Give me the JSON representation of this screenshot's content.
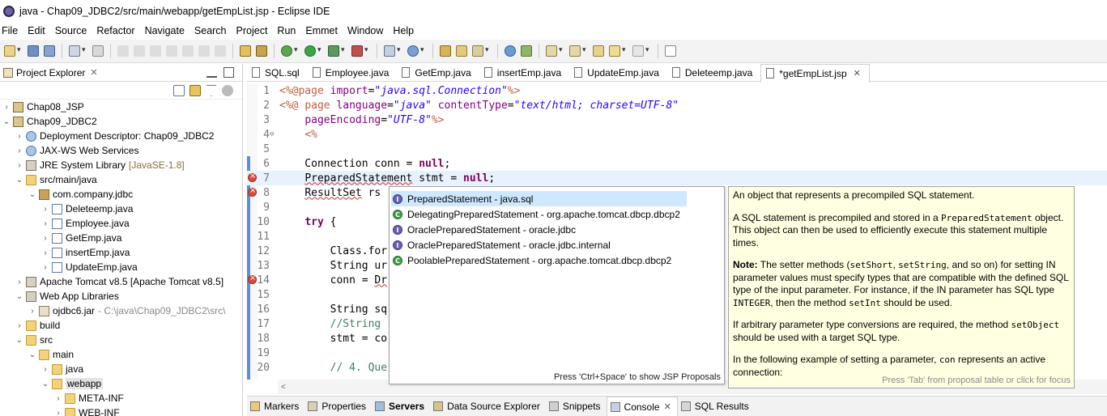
{
  "window": {
    "title": "java - Chap09_JDBC2/src/main/webapp/getEmpList.jsp - Eclipse IDE"
  },
  "menu": [
    "File",
    "Edit",
    "Source",
    "Refactor",
    "Navigate",
    "Search",
    "Project",
    "Run",
    "Emmet",
    "Window",
    "Help"
  ],
  "explorer": {
    "title": "Project Explorer",
    "tree": [
      {
        "label": "Chap08_JSP",
        "depth": 0,
        "twisty": ">",
        "icon": "project-icon"
      },
      {
        "label": "Chap09_JDBC2",
        "depth": 0,
        "twisty": "v",
        "icon": "project-icon"
      },
      {
        "label": "Deployment Descriptor: Chap09_JDBC2",
        "depth": 1,
        "twisty": ">",
        "icon": "web-icon"
      },
      {
        "label": "JAX-WS Web Services",
        "depth": 1,
        "twisty": ">",
        "icon": "web-icon"
      },
      {
        "label": "JRE System Library",
        "extra": "[JavaSE-1.8]",
        "depth": 1,
        "twisty": ">",
        "icon": "library-icon"
      },
      {
        "label": "src/main/java",
        "depth": 1,
        "twisty": "v",
        "icon": "folder-icon"
      },
      {
        "label": "com.company.jdbc",
        "depth": 2,
        "twisty": "v",
        "icon": "package-icon"
      },
      {
        "label": "Deleteemp.java",
        "depth": 3,
        "twisty": ">",
        "icon": "java-file-icon"
      },
      {
        "label": "Employee.java",
        "depth": 3,
        "twisty": ">",
        "icon": "java-file-icon"
      },
      {
        "label": "GetEmp.java",
        "depth": 3,
        "twisty": ">",
        "icon": "java-file-icon"
      },
      {
        "label": "insertEmp.java",
        "depth": 3,
        "twisty": ">",
        "icon": "java-file-icon"
      },
      {
        "label": "UpdateEmp.java",
        "depth": 3,
        "twisty": ">",
        "icon": "java-file-icon"
      },
      {
        "label": "Apache Tomcat v8.5 [Apache Tomcat v8.5]",
        "depth": 1,
        "twisty": ">",
        "icon": "library-icon"
      },
      {
        "label": "Web App Libraries",
        "depth": 1,
        "twisty": "v",
        "icon": "library-icon"
      },
      {
        "label": "ojdbc6.jar",
        "extra2": "- C:\\java\\Chap09_JDBC2\\src\\",
        "depth": 2,
        "twisty": ">",
        "icon": "jar-icon"
      },
      {
        "label": "build",
        "depth": 1,
        "twisty": ">",
        "icon": "folder-icon"
      },
      {
        "label": "src",
        "depth": 1,
        "twisty": "v",
        "icon": "folder-icon"
      },
      {
        "label": "main",
        "depth": 2,
        "twisty": "v",
        "icon": "folder-icon"
      },
      {
        "label": "java",
        "depth": 3,
        "twisty": ">",
        "icon": "folder-icon"
      },
      {
        "label": "webapp",
        "depth": 3,
        "twisty": "v",
        "icon": "folder-icon",
        "selected": true
      },
      {
        "label": "META-INF",
        "depth": 4,
        "twisty": ">",
        "icon": "folder-icon"
      },
      {
        "label": "WEB-INF",
        "depth": 4,
        "twisty": ">",
        "icon": "folder-icon"
      }
    ]
  },
  "editor": {
    "tabs": [
      {
        "label": "SQL.sql",
        "active": false
      },
      {
        "label": "Employee.java",
        "active": false
      },
      {
        "label": "GetEmp.java",
        "active": false
      },
      {
        "label": "insertEmp.java",
        "active": false
      },
      {
        "label": "UpdateEmp.java",
        "active": false
      },
      {
        "label": "Deleteemp.java",
        "active": false
      },
      {
        "label": "*getEmpList.jsp",
        "active": true
      }
    ],
    "lines": [
      {
        "n": "1",
        "html": "<span class=\"tag\">&lt;%@</span><span class=\"tag\">page</span> <span class=\"attr\">import</span>=<span class=\"s\">\"java.sql.Connection\"</span><span class=\"tag\">%&gt;</span>"
      },
      {
        "n": "2",
        "html": "<span class=\"tag\">&lt;%@</span> <span class=\"tag\">page</span> <span class=\"attr\">language</span>=<span class=\"s\">\"java\"</span> <span class=\"attr\">contentType</span>=<span class=\"s\">\"text/html; charset=UTF-8\"</span>"
      },
      {
        "n": "3",
        "html": "    <span class=\"attr\">pageEncoding</span>=<span class=\"s\">\"UTF-8\"</span><span class=\"tag\">%&gt;</span>"
      },
      {
        "n": "4",
        "fold": true,
        "html": "    <span class=\"tag\">&lt;%</span>"
      },
      {
        "n": "5",
        "html": ""
      },
      {
        "n": "6",
        "html": "    Connection conn = <span class=\"k\">null</span>;"
      },
      {
        "n": "7",
        "err": true,
        "cur": true,
        "html": "    <span class=\"squig\">PreparedStatement</span> stmt = <span class=\"k\">null</span>;"
      },
      {
        "n": "8",
        "err": true,
        "html": "    <span class=\"squig\">ResultSet</span> rs"
      },
      {
        "n": "9",
        "html": ""
      },
      {
        "n": "10",
        "html": "    <span class=\"k\">try</span> {"
      },
      {
        "n": "11",
        "html": ""
      },
      {
        "n": "12",
        "html": "        Class.for"
      },
      {
        "n": "13",
        "html": "        String ur"
      },
      {
        "n": "14",
        "err": true,
        "html": "        conn = <span class=\"squig\">Dr</span>"
      },
      {
        "n": "15",
        "html": ""
      },
      {
        "n": "16",
        "html": "        String sq"
      },
      {
        "n": "17",
        "html": "        <span class=\"cm\">//String </span>"
      },
      {
        "n": "18",
        "html": "        stmt = co"
      },
      {
        "n": "19",
        "html": ""
      },
      {
        "n": "20",
        "html": "        <span class=\"cm\">// 4. Que</span>"
      }
    ]
  },
  "assist": {
    "items": [
      {
        "label": "PreparedStatement - java.sql",
        "kind": "interface"
      },
      {
        "label": "DelegatingPreparedStatement - org.apache.tomcat.dbcp.dbcp2",
        "kind": "class"
      },
      {
        "label": "OraclePreparedStatement - oracle.jdbc",
        "kind": "interface"
      },
      {
        "label": "OraclePreparedStatement - oracle.jdbc.internal",
        "kind": "interface"
      },
      {
        "label": "PoolablePreparedStatement - org.apache.tomcat.dbcp.dbcp2",
        "kind": "class"
      }
    ],
    "hint": "Press 'Ctrl+Space' to show JSP Proposals"
  },
  "doc": {
    "p1": "An object that represents a precompiled SQL statement.",
    "p2_a": "A SQL statement is precompiled and stored in a ",
    "p2_code": "PreparedStatement",
    "p2_b": " object. This object can then be used to efficiently execute this statement multiple times.",
    "note_label": "Note:",
    "p3_a": " The setter methods (",
    "p3_c1": "setShort",
    "p3_sep": ", ",
    "p3_c2": "setString",
    "p3_b": ", and so on) for setting IN parameter values must specify types that are compatible with the defined SQL type of the input parameter. For instance, if the IN parameter has SQL type ",
    "p3_c3": "INTEGER",
    "p3_c": ", then the method ",
    "p3_c4": "setInt",
    "p3_d": " should be used.",
    "p4_a": "If arbitrary parameter type conversions are required, the method ",
    "p4_code": "setObject",
    "p4_b": " should be used with a target SQL type.",
    "p5_a": "In the following example of setting a parameter, ",
    "p5_code": "con",
    "p5_b": " represents an active connection:",
    "footer": "Press 'Tab' from proposal table or click for focus"
  },
  "bottom_tabs": [
    {
      "label": "Markers",
      "icon": "markers-icon"
    },
    {
      "label": "Properties",
      "icon": "properties-icon"
    },
    {
      "label": "Servers",
      "icon": "servers-icon",
      "bold": true
    },
    {
      "label": "Data Source Explorer",
      "icon": "datasource-icon"
    },
    {
      "label": "Snippets",
      "icon": "snippets-icon"
    },
    {
      "label": "Console",
      "icon": "console-icon",
      "selected": true
    },
    {
      "label": "SQL Results",
      "icon": "sql-results-icon"
    }
  ]
}
